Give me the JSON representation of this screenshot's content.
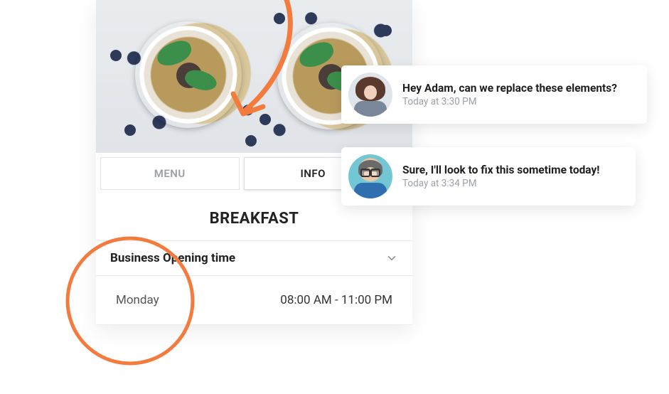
{
  "colors": {
    "accent": "#f47b3e"
  },
  "tabs": {
    "menu_label": "MENU",
    "info_label": "INFO"
  },
  "section": {
    "title": "BREAKFAST"
  },
  "accordion": {
    "title": "Business Opening time",
    "icon_name": "chevron-down-icon"
  },
  "hours": {
    "day": "Monday",
    "range": "08:00 AM - 11:00 PM"
  },
  "comments": [
    {
      "message": "Hey Adam, can we replace these elements?",
      "timestamp": "Today at 3:30 PM",
      "avatar": "avatar-female"
    },
    {
      "message": "Sure, I'll look to fix this sometime today!",
      "timestamp": "Today at 3:34 PM",
      "avatar": "avatar-male"
    }
  ]
}
